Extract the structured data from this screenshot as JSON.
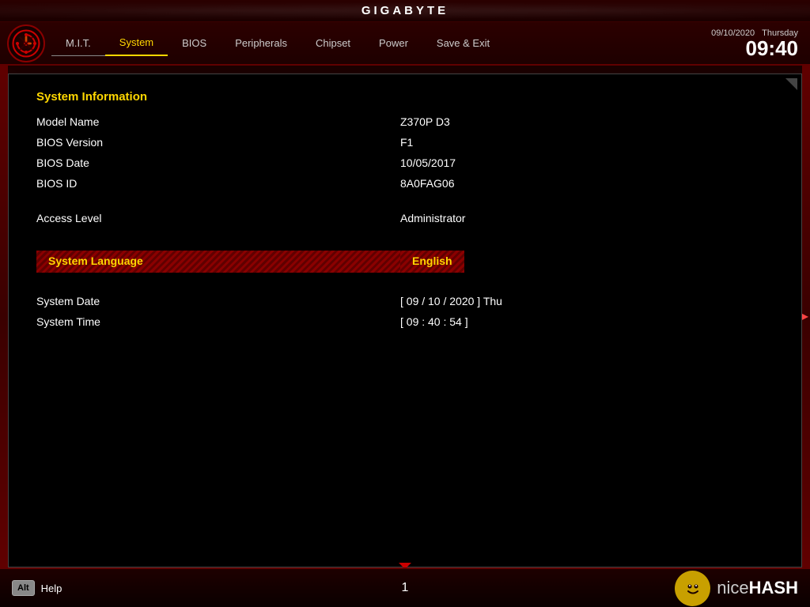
{
  "header": {
    "title": "GIGABYTE"
  },
  "datetime": {
    "date": "09/10/2020",
    "day": "Thursday",
    "time": "09:40"
  },
  "nav": {
    "items": [
      {
        "id": "mit",
        "label": "M.I.T.",
        "active": false
      },
      {
        "id": "system",
        "label": "System",
        "active": true
      },
      {
        "id": "bios",
        "label": "BIOS",
        "active": false
      },
      {
        "id": "peripherals",
        "label": "Peripherals",
        "active": false
      },
      {
        "id": "chipset",
        "label": "Chipset",
        "active": false
      },
      {
        "id": "power",
        "label": "Power",
        "active": false
      },
      {
        "id": "save-exit",
        "label": "Save & Exit",
        "active": false
      }
    ]
  },
  "system_info": {
    "section_title": "System Information",
    "fields": [
      {
        "label": "Model Name",
        "value": "Z370P D3"
      },
      {
        "label": "BIOS Version",
        "value": "F1"
      },
      {
        "label": "BIOS Date",
        "value": "10/05/2017"
      },
      {
        "label": "BIOS ID",
        "value": "8A0FAG06"
      }
    ],
    "access_level_label": "Access Level",
    "access_level_value": "Administrator",
    "language_label": "System Language",
    "language_value": "English",
    "date_label": "System Date",
    "date_value": "[ 09 / 10 / 2020 ]   Thu",
    "time_label": "System Time",
    "time_value": "[ 09 :  40 : 54 ]"
  },
  "bottom": {
    "alt_key": "Alt",
    "help_label": "Help",
    "page_number": "1",
    "nicehash_name": "niceHASH"
  }
}
